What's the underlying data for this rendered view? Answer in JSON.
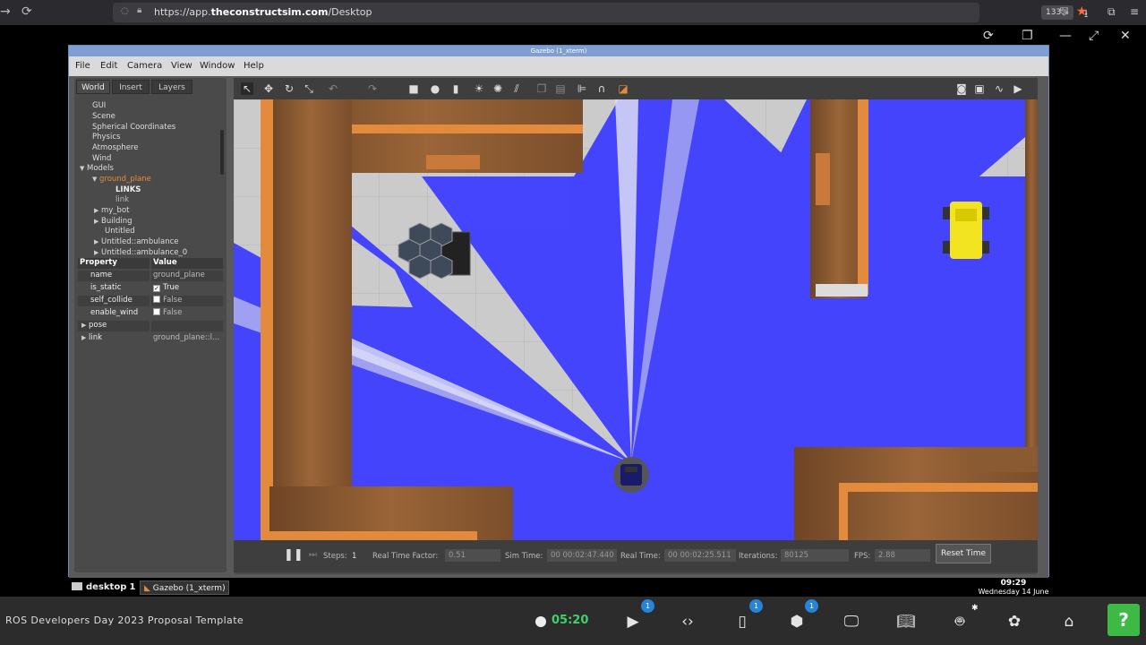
{
  "browser": {
    "url_prefix": "https://app.",
    "url_domain": "theconstructsim.com",
    "url_path": "/Desktop",
    "zoom": "133%"
  },
  "window": {
    "title": "Gazebo (1_xterm)"
  },
  "menu": [
    "File",
    "Edit",
    "Camera",
    "View",
    "Window",
    "Help"
  ],
  "left_panel": {
    "tabs": [
      "World",
      "Insert",
      "Layers"
    ],
    "tree": {
      "gui": "GUI",
      "scene": "Scene",
      "spherical": "Spherical Coordinates",
      "physics": "Physics",
      "atmosphere": "Atmosphere",
      "wind": "Wind",
      "models": "Models",
      "ground_plane": "ground_plane",
      "links": "LINKS",
      "link": "link",
      "my_bot": "my_bot",
      "building": "Building",
      "untitled": "Untitled",
      "ambulance": "Untitled::ambulance",
      "ambulance_0": "Untitled::ambulance_0"
    },
    "properties": {
      "header_property": "Property",
      "header_value": "Value",
      "name_key": "name",
      "name_val": "ground_plane",
      "is_static_key": "is_static",
      "is_static_val": "True",
      "self_collide_key": "self_collide",
      "self_collide_val": "False",
      "enable_wind_key": "enable_wind",
      "enable_wind_val": "False",
      "pose_key": "pose",
      "link_key": "link",
      "link_val": "ground_plane::l..."
    }
  },
  "bottom_bar": {
    "steps_label": "Steps:",
    "steps_val": "1",
    "rtf_label": "Real Time Factor:",
    "rtf_val": "0.51",
    "sim_time_label": "Sim Time:",
    "sim_time_val": "00 00:02:47.440",
    "real_time_label": "Real Time:",
    "real_time_val": "00 00:02:25.511",
    "iterations_label": "Iterations:",
    "iterations_val": "80125",
    "fps_label": "FPS:",
    "fps_val": "2.88",
    "reset_label": "Reset Time"
  },
  "taskbar": {
    "desktop": "desktop",
    "desktop_num": "1",
    "gazebo_task": "Gazebo (1_xterm)",
    "clock_time": "09:29",
    "clock_date": "Wednesday 14 June"
  },
  "appbar": {
    "project_title": "ROS Developers Day 2023 Proposal Template",
    "timer": "05:20",
    "badge_shell": "1",
    "badge_notebook": "1",
    "badge_package": "1",
    "help": "?"
  },
  "colors": {
    "laser": "#3d3dff",
    "wall_orange": "#e48a3c",
    "wood": "#8a5a32",
    "help_green": "#3fb946",
    "timer_green": "#3fd16a",
    "title_blue": "#7f9fd4"
  }
}
